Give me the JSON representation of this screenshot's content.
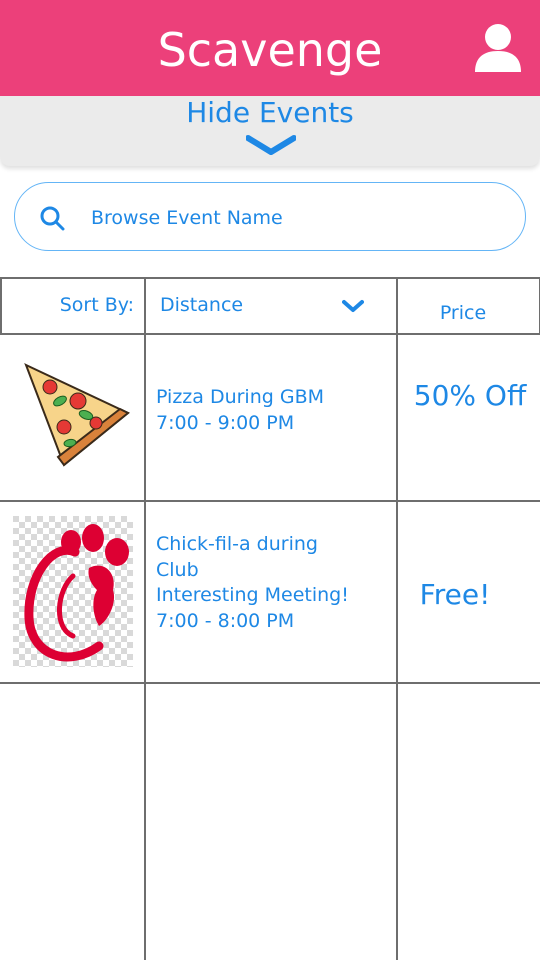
{
  "header": {
    "title": "Scavenge",
    "profile_icon": "user-icon",
    "background_color": "#ec407a"
  },
  "toggle": {
    "label": "Hide Events",
    "icon": "chevron-down-icon"
  },
  "search": {
    "placeholder": "Browse Event Name",
    "value": "",
    "icon": "search-icon"
  },
  "table": {
    "sort_label": "Sort By:",
    "sort_value": "Distance",
    "price_header": "Price",
    "rows": [
      {
        "image_icon": "pizza-slice-icon",
        "name": "Pizza During GBM",
        "time": "7:00 - 9:00 PM",
        "price": "50% Off"
      },
      {
        "image_icon": "chick-fil-a-logo",
        "name_line1": "Chick-fil-a during",
        "name_line2": "Club",
        "name_line3": "Interesting Meeting!",
        "time": "7:00 - 8:00 PM",
        "price": "Free!"
      }
    ]
  },
  "colors": {
    "accent": "#1e88e5",
    "brand": "#ec407a",
    "toggle_background": "#ebebeb",
    "grid": "#6e6e6e"
  }
}
